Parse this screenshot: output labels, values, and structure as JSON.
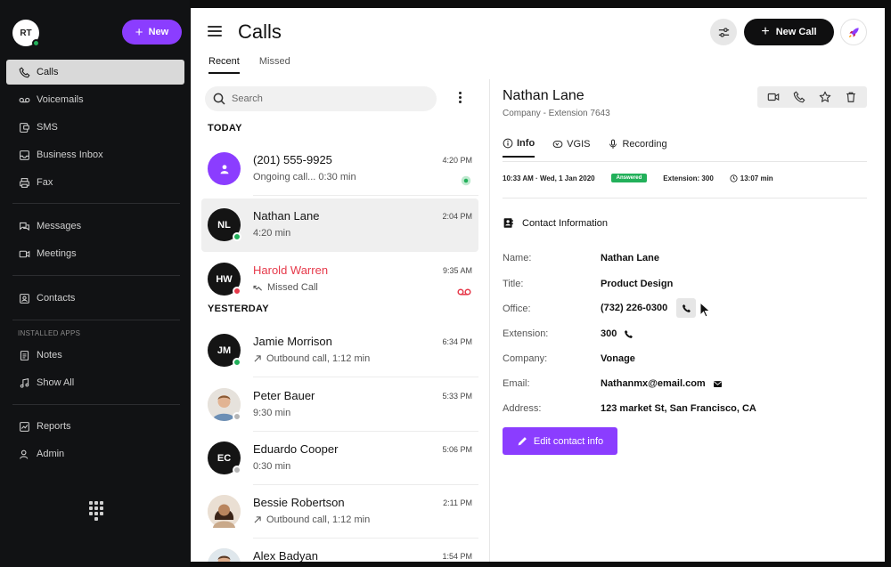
{
  "sidebar": {
    "user_initials": "RT",
    "new_label": "New",
    "items": [
      {
        "label": "Calls",
        "icon": "phone-icon"
      },
      {
        "label": "Voicemails",
        "icon": "voicemail-icon"
      },
      {
        "label": "SMS",
        "icon": "sms-icon"
      },
      {
        "label": "Business Inbox",
        "icon": "inbox-icon"
      },
      {
        "label": "Fax",
        "icon": "fax-icon"
      },
      {
        "label": "Messages",
        "icon": "messages-icon"
      },
      {
        "label": "Meetings",
        "icon": "meetings-icon"
      },
      {
        "label": "Contacts",
        "icon": "contacts-icon"
      },
      {
        "label": "Notes",
        "icon": "notes-icon"
      },
      {
        "label": "Show All",
        "icon": "music-icon"
      },
      {
        "label": "Reports",
        "icon": "reports-icon"
      },
      {
        "label": "Admin",
        "icon": "admin-icon"
      }
    ],
    "installed_apps_label": "INSTALLED APPS"
  },
  "header": {
    "title": "Calls",
    "tabs": [
      {
        "label": "Recent"
      },
      {
        "label": "Missed"
      }
    ],
    "new_call_label": "New Call"
  },
  "list": {
    "search_placeholder": "Search",
    "today_label": "TODAY",
    "yesterday_label": "YESTERDAY",
    "calls": [
      {
        "name": "(201) 555-9925",
        "sub": "Ongoing call... 0:30 min",
        "time": "4:20 PM",
        "initials": ""
      },
      {
        "name": "Nathan Lane",
        "sub": "4:20 min",
        "time": "2:04 PM",
        "initials": "NL"
      },
      {
        "name": "Harold Warren",
        "sub": "Missed Call",
        "time": "9:35 AM",
        "initials": "HW"
      },
      {
        "name": "Jamie Morrison",
        "sub": "Outbound call, 1:12 min",
        "time": "6:34 PM",
        "initials": "JM"
      },
      {
        "name": "Peter Bauer",
        "sub": "9:30 min",
        "time": "5:33 PM",
        "initials": ""
      },
      {
        "name": "Eduardo Cooper",
        "sub": "0:30 min",
        "time": "5:06 PM",
        "initials": "EC"
      },
      {
        "name": "Bessie Robertson",
        "sub": "Outbound call, 1:12 min",
        "time": "2:11 PM",
        "initials": ""
      },
      {
        "name": "Alex Badyan",
        "sub": "",
        "time": "1:54 PM",
        "initials": ""
      }
    ]
  },
  "detail": {
    "name": "Nathan Lane",
    "subtitle": "Company -  Extension 7643",
    "tabs": [
      {
        "label": "Info"
      },
      {
        "label": "VGIS"
      },
      {
        "label": "Recording"
      }
    ],
    "meta": {
      "datetime": "10:33 AM  ·  Wed, 1 Jan 2020",
      "status": "Answered",
      "extension": "Extension:  300",
      "duration": "13:07 min"
    },
    "contact_heading": "Contact Information",
    "fields": [
      {
        "label": "Name:",
        "value": "Nathan Lane"
      },
      {
        "label": "Title:",
        "value": "Product  Design"
      },
      {
        "label": "Office:",
        "value": "(732) 226-0300"
      },
      {
        "label": "Extension:",
        "value": "300"
      },
      {
        "label": "Company:",
        "value": "Vonage"
      },
      {
        "label": "Email:",
        "value": "Nathanmx@email.com"
      },
      {
        "label": "Address:",
        "value": "123 market St, San Francisco, CA"
      }
    ],
    "edit_label": "Edit contact info"
  },
  "colors": {
    "accent": "#8b3dff",
    "missed": "#e6394a",
    "online": "#22b05a",
    "answered": "#22b05a"
  }
}
